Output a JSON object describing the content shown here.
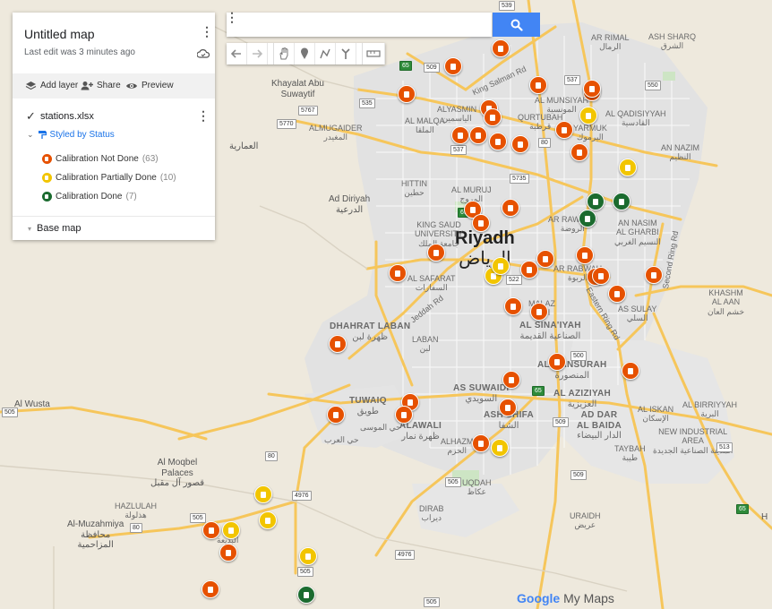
{
  "panel": {
    "title": "Untitled map",
    "subtitle": "Last edit was 3 minutes ago",
    "actions": {
      "add_layer": "Add layer",
      "share": "Share",
      "preview": "Preview"
    },
    "layer": {
      "name": "stations.xlsx",
      "styled_by": "Styled by Status",
      "legend": [
        {
          "label": "Calibration Not Done",
          "count": "(63)",
          "color": "#e65100"
        },
        {
          "label": "Calibration Partially Done",
          "count": "(10)",
          "color": "#f2c500"
        },
        {
          "label": "Calibration Done",
          "count": "(7)",
          "color": "#1b6b2f"
        }
      ]
    },
    "base_map": "Base map"
  },
  "search": {
    "placeholder": ""
  },
  "toolbar": [
    "undo-icon",
    "redo-icon",
    "hand-icon",
    "marker-icon",
    "polyline-icon",
    "directions-icon",
    "ruler-icon"
  ],
  "watermark": {
    "google": "Google",
    "product": "My Maps"
  },
  "places": {
    "riyadh": "Riyadh",
    "riyadh_ar": "الرياض",
    "khayalat": "Khayalat Abu",
    "suwaytif": "Suwaytif",
    "ammariyah": "العمارية",
    "ad_diriyah": "Ad Diriyah",
    "ad_diriyah_ar": "الدرعية",
    "almugaider": "ALMUGAIDER",
    "almugaider_ar": "المغيدر",
    "al_maloa": "AL MALQA",
    "al_maloa_ar": "الملقا",
    "alyasmin": "ALYASMIN",
    "alyasmin_ar": "الياسمين",
    "qurtubah": "QURTUBAH",
    "qurtubah_ar": "قرطبة",
    "al_munsiyah": "AL MUNSIYAH",
    "al_munsiyah_ar": "المونسية",
    "ar_rimal": "AR RIMAL",
    "ar_rimal_ar": "الرمال",
    "ash_sharq": "ASH SHARQ",
    "ash_sharq_ar": "الشرق",
    "al_qadisiyyah": "AL QADISIYYAH",
    "al_qadisiyyah_ar": "القادسية",
    "yarmuk": "YARMUK",
    "yarmuk_ar": "اليرموك",
    "an_nazim": "AN NAZIM",
    "an_nazim_ar": "النظيم",
    "hittin": "HITTIN",
    "hittin_ar": "حطين",
    "al_muruj": "AL MURUJ",
    "al_muruj_ar": "المروج",
    "ar_rawdah": "AR RAWDAH",
    "ar_rawdah_ar": "الروضة",
    "an_nasim": "AN NASIM",
    "al_gharbi": "AL GHARBI",
    "an_nasim_ar": "النسيم الغربي",
    "king_saud": "KING SAUD",
    "university": "UNIVERSITY",
    "king_saud_ar": "جامعة الملك",
    "ar_rabwah": "AR RABWAH",
    "ar_rabwah_ar": "الربوة",
    "al_safarat": "AL SAFARAT",
    "al_safarat_ar": "السفارات",
    "malaz": "MALAZ",
    "malaz_ar": "الملز",
    "as_sulay": "AS SULAY",
    "as_sulay_ar": "السلي",
    "khashm": "KHASHM",
    "al_aan": "AL AAN",
    "khashm_ar": "خشم العان",
    "dhahrat_laban": "DHAHRAT LABAN",
    "dhahrat_laban_ar": "ظهرة لبن",
    "laban": "LABAN",
    "laban_ar": "لبن",
    "al_sinaiyah": "AL SINA'IYAH",
    "al_sinaiyah_ar": "الصناعية القديمة",
    "al_mansurah": "AL MANSURAH",
    "al_mansurah_ar": "المنصورة",
    "as_suwaidi": "AS SUWAIDI",
    "as_suwaidi_ar": "السويدي",
    "al_aziziyah": "AL AZIZIYAH",
    "al_aziziyah_ar": "العزيزية",
    "tuwaiq": "TUWAIQ",
    "tuwaiq_ar": "طويق",
    "hai_al_moussa": "حي الموسى",
    "alawali": "ALAWALI",
    "alawali_ar": "ظهرة نمار",
    "ash_shifa": "ASH SHIFA",
    "ash_shifa_ar": "الشفا",
    "ad_dar": "AD DAR",
    "al_baida": "AL BAIDA",
    "ad_dar_ar": "الدار البيضاء",
    "al_iskan": "AL ISKAN",
    "al_iskan_ar": "الإسكان",
    "al_birriyyah": "AL BIRRIYYAH",
    "al_birriyyah_ar": "البرية",
    "new_industrial": "NEW INDUSTRIAL",
    "area": "AREA",
    "new_industrial_ar": "المدينة الصناعية الجديدة",
    "taybah": "TAYBAH",
    "taybah_ar": "طيبة",
    "al_wusta": "Al Wusta",
    "hai_al_arab": "حي العرب",
    "alhazm": "ALHAZM",
    "alhazm_ar": "الحزم",
    "uqdah": "UQDAH",
    "uqdah_ar": "عكاظ",
    "al_moqbel": "Al Moqbel",
    "palaces": "Palaces",
    "al_moqbel_ar": "قصور آل مقبل",
    "hazlulah": "HAZLULAH",
    "hazlulah_ar": "هذلولة",
    "dirab": "DIRAB",
    "dirab_ar": "ديراب",
    "uraidh": "URAIDH",
    "uraidh_ar": "عريض",
    "al_muzahmiya": "Al-Muzahmiya",
    "al_muzahmiya_ar1": "محافظة",
    "al_muzahmiya_ar2": "المزاحمية",
    "al_badiah_ar": "البديعة",
    "king_salman": "King Salman Rd",
    "eastern_ring": "Eastern Ring Rd",
    "jeddah_rd": "Jeddah Rd",
    "second_ring": "Second Ring Rd",
    "wl": "H"
  },
  "shields": [
    "539",
    "65",
    "509",
    "535",
    "537",
    "550",
    "5767",
    "5770",
    "537",
    "80",
    "5735",
    "65",
    "522",
    "500",
    "65",
    "509",
    "80",
    "505",
    "4976",
    "505",
    "509",
    "513",
    "65",
    "505",
    "80",
    "4976",
    "505",
    "505"
  ],
  "map_colors": {
    "land": "#eee9dd",
    "urban": "#e1e1e1",
    "road_major": "#f6c65b",
    "road_minor": "#ffffff",
    "park": "#cde5c4"
  }
}
